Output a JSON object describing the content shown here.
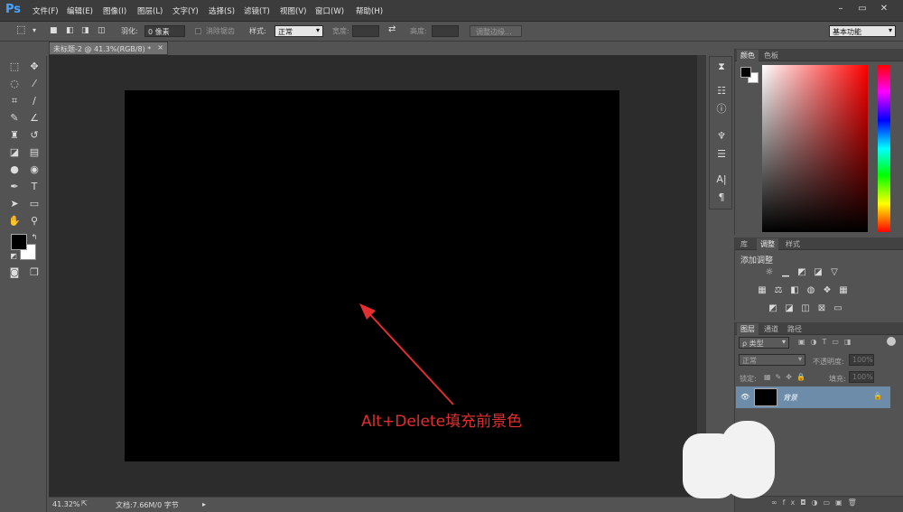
{
  "app": {
    "logo": "Ps",
    "menus": [
      "文件(F)",
      "编辑(E)",
      "图像(I)",
      "图层(L)",
      "文字(Y)",
      "选择(S)",
      "滤镜(T)",
      "视图(V)",
      "窗口(W)",
      "帮助(H)"
    ]
  },
  "options": {
    "feather_label": "羽化:",
    "feather_value": "0 像素",
    "antialias_label": "消除锯齿",
    "style_label": "样式:",
    "style_value": "正常",
    "width_label": "宽度:",
    "height_label": "高度:",
    "refine_button": "调整边缘...",
    "workspace": "基本功能"
  },
  "document": {
    "tab_title": "未标题-2 @ 41.3%(RGB/8) *",
    "zoom": "41.32%",
    "doc_info": "文档:7.66M/0 字节"
  },
  "color_panel": {
    "tabs": [
      "颜色",
      "色板"
    ],
    "fg_color": "#000000",
    "bg_color": "#ffffff"
  },
  "adjustments_panel": {
    "tabs": [
      "库",
      "调整",
      "样式"
    ],
    "title": "添加调整"
  },
  "layers_panel": {
    "tabs": [
      "图层",
      "通道",
      "路径"
    ],
    "filter_kind": "ρ 类型",
    "blend_mode": "正常",
    "opacity_label": "不透明度:",
    "opacity_value": "100%",
    "lock_label": "锁定:",
    "fill_label": "填充:",
    "fill_value": "100%",
    "layers": [
      {
        "name": "背景"
      }
    ]
  },
  "annotation": {
    "text": "Alt+Delete填充前景色",
    "color": "#e12e2e"
  }
}
